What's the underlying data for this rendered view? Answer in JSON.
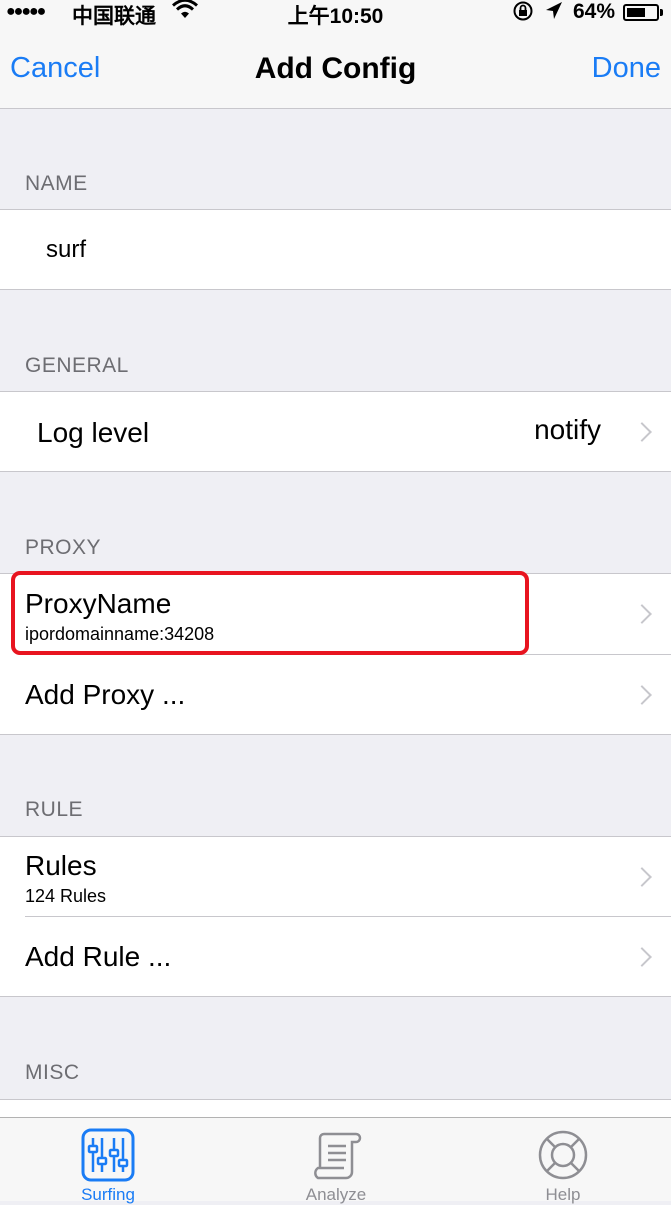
{
  "status": {
    "signal": "●●●●●",
    "carrier": "中国联通",
    "time": "上午10:50",
    "battery": "64%",
    "battery_level": 0.64
  },
  "nav": {
    "cancel": "Cancel",
    "title": "Add Config",
    "done": "Done"
  },
  "name_section": {
    "header": "NAME",
    "value": "surf"
  },
  "general_section": {
    "header": "GENERAL",
    "log_level_label": "Log level",
    "log_level_value": "notify"
  },
  "proxy_section": {
    "header": "PROXY",
    "proxy_name": "ProxyName",
    "proxy_address": "ipordomainname:34208",
    "add_proxy": "Add Proxy ..."
  },
  "rule_section": {
    "header": "RULE",
    "rules_label": "Rules",
    "rules_count": "124 Rules",
    "add_rule": "Add Rule ..."
  },
  "misc_section": {
    "header": "MISC"
  },
  "tabs": [
    {
      "label": "Surfing",
      "icon": "sliders-icon",
      "active": true
    },
    {
      "label": "Analyze",
      "icon": "scroll-icon",
      "active": false
    },
    {
      "label": "Help",
      "icon": "lifebuoy-icon",
      "active": false
    }
  ],
  "colors": {
    "accent": "#1a7cf5",
    "highlight": "#e8141f"
  }
}
